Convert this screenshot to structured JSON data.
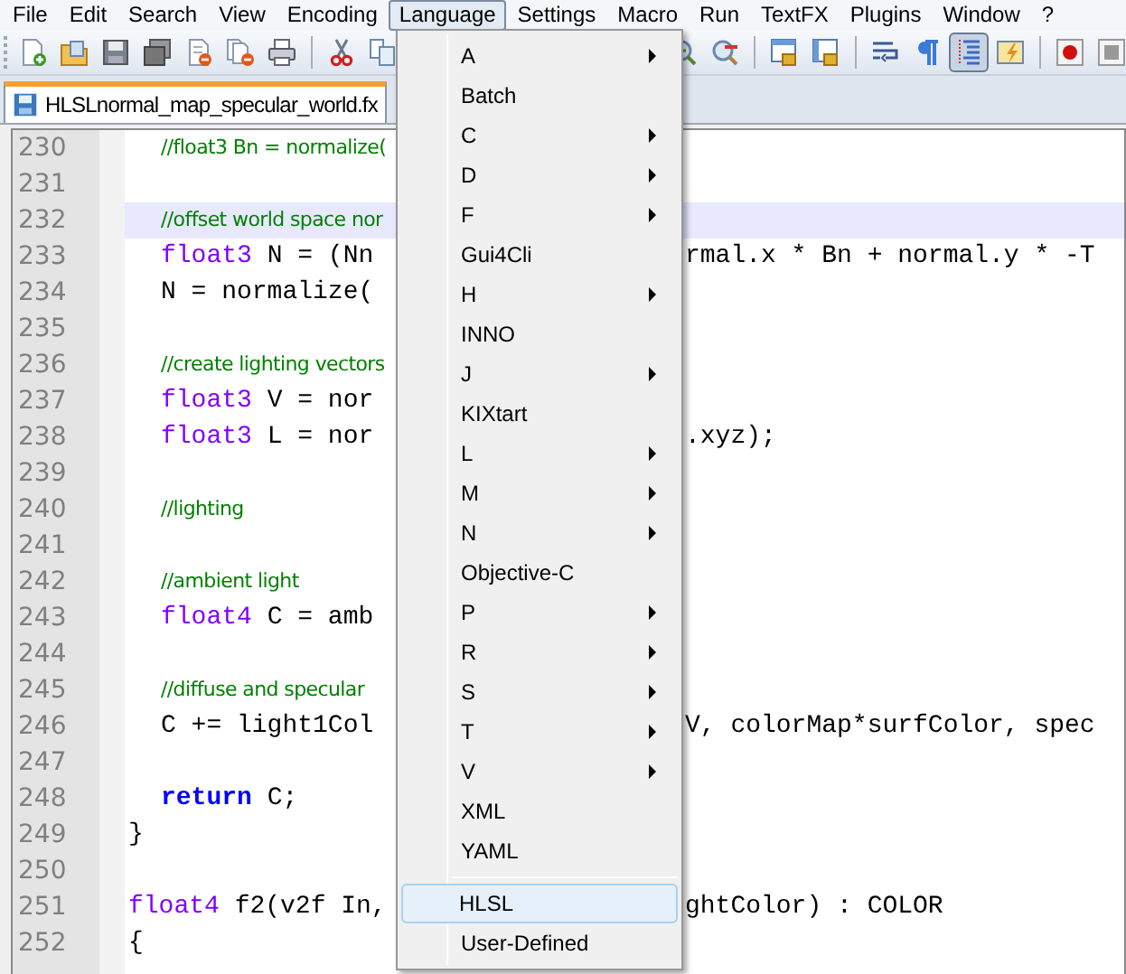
{
  "menu_bar": [
    {
      "label": "File",
      "selected": false
    },
    {
      "label": "Edit",
      "selected": false
    },
    {
      "label": "Search",
      "selected": false
    },
    {
      "label": "View",
      "selected": false
    },
    {
      "label": "Encoding",
      "selected": false
    },
    {
      "label": "Language",
      "selected": true
    },
    {
      "label": "Settings",
      "selected": false
    },
    {
      "label": "Macro",
      "selected": false
    },
    {
      "label": "Run",
      "selected": false
    },
    {
      "label": "TextFX",
      "selected": false
    },
    {
      "label": "Plugins",
      "selected": false
    },
    {
      "label": "Window",
      "selected": false
    },
    {
      "label": "?",
      "selected": false
    }
  ],
  "toolbar": {
    "left": [
      {
        "kind": "new"
      },
      {
        "kind": "open"
      },
      {
        "kind": "save"
      },
      {
        "kind": "save_all"
      },
      {
        "kind": "close"
      },
      {
        "kind": "close_all"
      },
      {
        "kind": "print"
      },
      {
        "kind": "separator"
      },
      {
        "kind": "cut"
      },
      {
        "kind": "copy"
      }
    ],
    "right": [
      {
        "kind": "zoom_in",
        "pressed": false
      },
      {
        "kind": "zoom_out",
        "pressed": false
      },
      {
        "kind": "separator"
      },
      {
        "kind": "sync_v",
        "pressed": false
      },
      {
        "kind": "sync_h",
        "pressed": false
      },
      {
        "kind": "separator"
      },
      {
        "kind": "wrap",
        "pressed": false
      },
      {
        "kind": "pilcrow",
        "pressed": false
      },
      {
        "kind": "indent_guide",
        "pressed": true
      },
      {
        "kind": "lightning",
        "pressed": false
      },
      {
        "kind": "separator"
      },
      {
        "kind": "record",
        "pressed": false
      },
      {
        "kind": "stop",
        "pressed": false
      }
    ]
  },
  "tabs": [
    {
      "label": "HLSLnormal_map_specular_world.fx",
      "selected": true
    }
  ],
  "editor": {
    "lines": [
      {
        "kind": "block",
        "children": [
          {
            "number": "230",
            "left": [
              {
                "kind": "comment",
                "text": "//float3 Bn = normalize("
              }
            ]
          },
          {
            "number": "231"
          },
          {
            "number": "232",
            "current": true,
            "left": [
              {
                "kind": "comment",
                "text": "//offset world space nor"
              }
            ]
          },
          {
            "number": "233",
            "left": [
              {
                "kind": "type",
                "text": "float3"
              },
              {
                "kind": "plain",
                "text": " N = (Nn"
              }
            ],
            "right": [
              {
                "kind": "plain",
                "text": "rmal.x * Bn + normal.y * -T"
              }
            ]
          },
          {
            "number": "234",
            "left": [
              {
                "kind": "plain",
                "text": "N = normalize("
              }
            ]
          },
          {
            "number": "235"
          },
          {
            "number": "236",
            "left": [
              {
                "kind": "comment",
                "text": "//create lighting vectors"
              }
            ]
          },
          {
            "number": "237",
            "left": [
              {
                "kind": "type",
                "text": "float3"
              },
              {
                "kind": "plain",
                "text": " V = nor"
              }
            ]
          },
          {
            "number": "238",
            "left": [
              {
                "kind": "type",
                "text": "float3"
              },
              {
                "kind": "plain",
                "text": " L = nor"
              }
            ],
            "right": [
              {
                "kind": "plain",
                "text": ".xyz);"
              }
            ]
          },
          {
            "number": "239"
          },
          {
            "number": "240",
            "left": [
              {
                "kind": "comment",
                "text": "//lighting"
              }
            ]
          },
          {
            "number": "241"
          },
          {
            "number": "242",
            "left": [
              {
                "kind": "comment",
                "text": "//ambient light"
              }
            ]
          },
          {
            "number": "243",
            "left": [
              {
                "kind": "type",
                "text": "float4"
              },
              {
                "kind": "plain",
                "text": " C = amb"
              }
            ]
          },
          {
            "number": "244"
          },
          {
            "number": "245",
            "left": [
              {
                "kind": "comment",
                "text": "//diffuse and specular"
              }
            ]
          },
          {
            "number": "246",
            "left": [
              {
                "kind": "plain",
                "text": "C += light1Col"
              }
            ],
            "right": [
              {
                "kind": "plain",
                "text": "V, colorMap*surfColor, spec"
              }
            ]
          },
          {
            "number": "247"
          },
          {
            "number": "248",
            "left": [
              {
                "kind": "keyword",
                "text": "return"
              },
              {
                "kind": "plain",
                "text": " C;"
              }
            ]
          }
        ]
      },
      {
        "number": "249",
        "left": [
          {
            "kind": "plain",
            "text": "}"
          }
        ]
      },
      {
        "number": "250"
      },
      {
        "number": "251",
        "left": [
          {
            "kind": "type",
            "text": "float4"
          },
          {
            "kind": "plain",
            "text": " f2(v2f In,"
          }
        ],
        "right": [
          {
            "kind": "plain",
            "text": "ghtColor) : COLOR"
          }
        ]
      },
      {
        "number": "252",
        "left": [
          {
            "kind": "plain",
            "text": "{"
          }
        ]
      }
    ]
  },
  "language_menu": [
    {
      "kind": "item",
      "label": "A",
      "submenu": true,
      "selected": false
    },
    {
      "kind": "item",
      "label": "Batch",
      "submenu": false,
      "selected": false
    },
    {
      "kind": "item",
      "label": "C",
      "submenu": true,
      "selected": false
    },
    {
      "kind": "item",
      "label": "D",
      "submenu": true,
      "selected": false
    },
    {
      "kind": "item",
      "label": "F",
      "submenu": true,
      "selected": false
    },
    {
      "kind": "item",
      "label": "Gui4Cli",
      "submenu": false,
      "selected": false
    },
    {
      "kind": "item",
      "label": "H",
      "submenu": true,
      "selected": false
    },
    {
      "kind": "item",
      "label": "INNO",
      "submenu": false,
      "selected": false
    },
    {
      "kind": "item",
      "label": "J",
      "submenu": true,
      "selected": false
    },
    {
      "kind": "item",
      "label": "KIXtart",
      "submenu": false,
      "selected": false
    },
    {
      "kind": "item",
      "label": "L",
      "submenu": true,
      "selected": false
    },
    {
      "kind": "item",
      "label": "M",
      "submenu": true,
      "selected": false
    },
    {
      "kind": "item",
      "label": "N",
      "submenu": true,
      "selected": false
    },
    {
      "kind": "item",
      "label": "Objective-C",
      "submenu": false,
      "selected": false
    },
    {
      "kind": "item",
      "label": "P",
      "submenu": true,
      "selected": false
    },
    {
      "kind": "item",
      "label": "R",
      "submenu": true,
      "selected": false
    },
    {
      "kind": "item",
      "label": "S",
      "submenu": true,
      "selected": false
    },
    {
      "kind": "item",
      "label": "T",
      "submenu": true,
      "selected": false
    },
    {
      "kind": "item",
      "label": "V",
      "submenu": true,
      "selected": false
    },
    {
      "kind": "item",
      "label": "XML",
      "submenu": false,
      "selected": false
    },
    {
      "kind": "item",
      "label": "YAML",
      "submenu": false,
      "selected": false
    },
    {
      "kind": "separator"
    },
    {
      "kind": "item",
      "label": "HLSL",
      "submenu": false,
      "selected": true
    },
    {
      "kind": "item",
      "label": "User-Defined",
      "submenu": false,
      "selected": false
    }
  ]
}
